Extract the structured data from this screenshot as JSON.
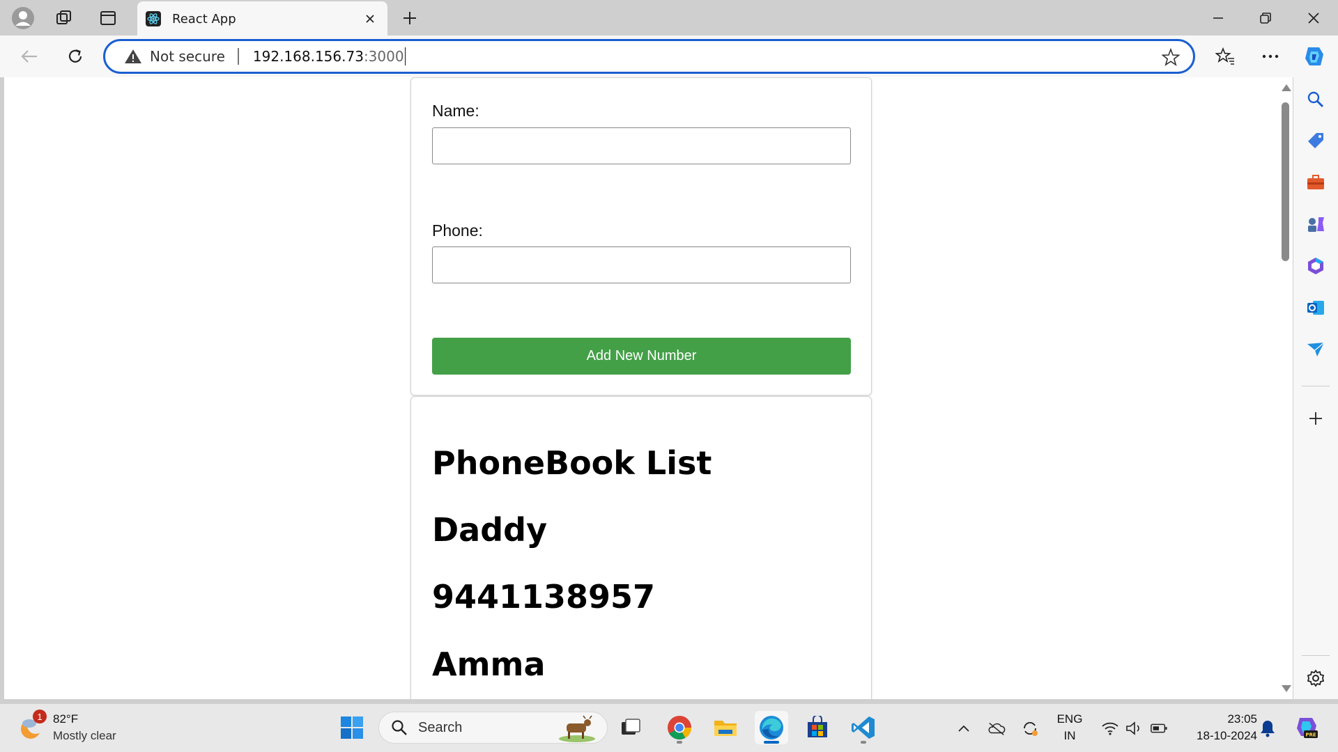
{
  "tab": {
    "title": "React App",
    "favicon": "react-icon"
  },
  "address": {
    "security_label": "Not secure",
    "host": "192.168.156.73",
    "port": ":3000"
  },
  "form": {
    "name_label": "Name:",
    "name_value": "",
    "phone_label": "Phone:",
    "phone_value": "",
    "submit_label": "Add New Number",
    "submit_color": "#43a047"
  },
  "phonebook": {
    "heading": "PhoneBook List",
    "entries": [
      "Daddy",
      "9441138957",
      "Amma"
    ]
  },
  "taskbar": {
    "weather": {
      "temp": "82°F",
      "desc": "Mostly clear",
      "badge": "1"
    },
    "search_label": "Search",
    "lang_line1": "ENG",
    "lang_line2": "IN",
    "time": "23:05",
    "date": "18-10-2024"
  },
  "colors": {
    "accent": "#1a5fd1",
    "taskbar_active": "#0067c0"
  }
}
